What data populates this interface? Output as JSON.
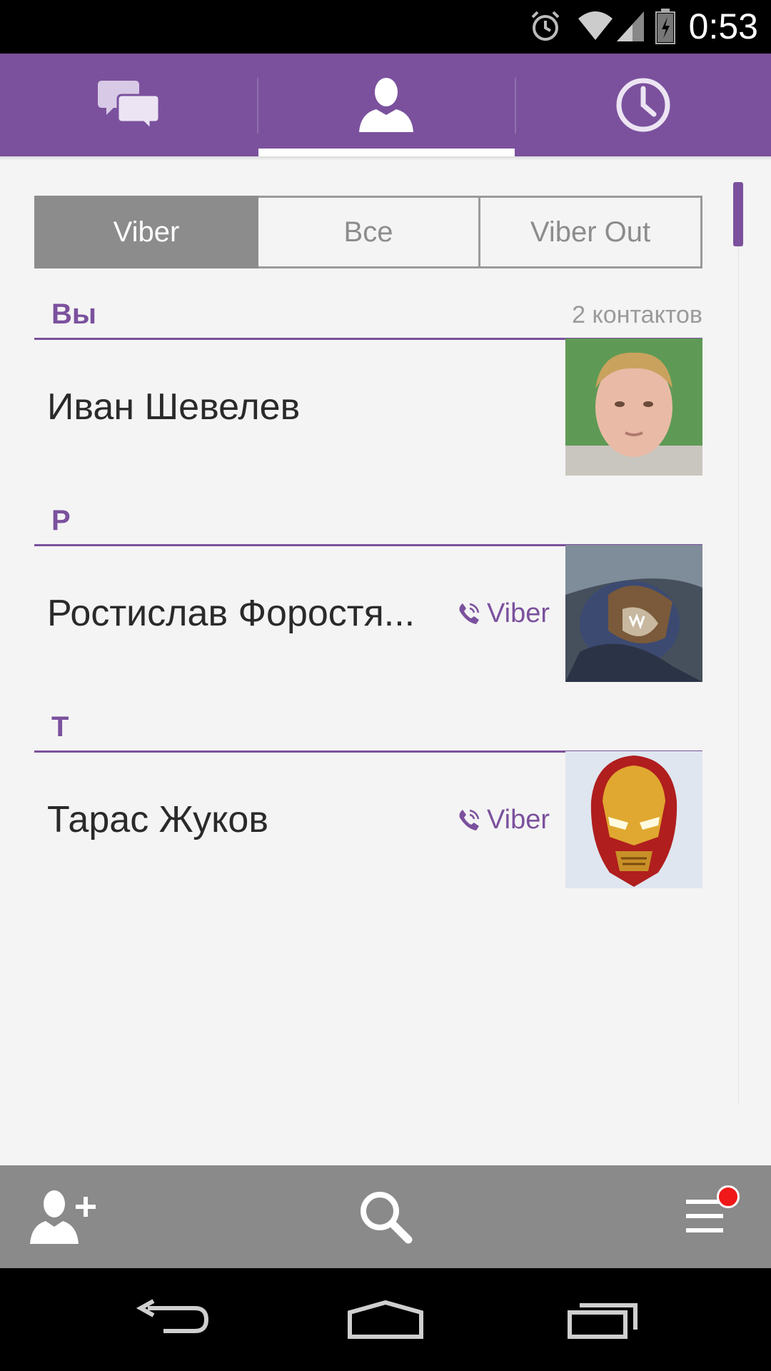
{
  "status_bar": {
    "time": "0:53"
  },
  "top_tabs": [
    {
      "icon": "chat-bubbles-icon"
    },
    {
      "icon": "contact-person-icon",
      "active": true
    },
    {
      "icon": "clock-history-icon"
    }
  ],
  "filter": {
    "tabs": [
      {
        "label": "Viber",
        "active": true
      },
      {
        "label": "Все"
      },
      {
        "label": "Viber Out"
      }
    ]
  },
  "sections": [
    {
      "header": "Вы",
      "count": "2 контактов",
      "contacts": [
        {
          "name": "Иван Шевелев",
          "viber": false
        }
      ]
    },
    {
      "header": "Р",
      "contacts": [
        {
          "name": "Ростислав Форостя...",
          "viber": true,
          "badge": "Viber"
        }
      ]
    },
    {
      "header": "Т",
      "contacts": [
        {
          "name": "Тарас Жуков",
          "viber": true,
          "badge": "Viber"
        }
      ]
    }
  ],
  "bottom_bar": {
    "add_contact_icon": "add-contact-icon",
    "search_icon": "search-icon",
    "menu_icon": "menu-icon",
    "menu_has_notification": true
  },
  "colors": {
    "accent": "#7b519d",
    "bottom_bar": "#8a8a8a"
  }
}
